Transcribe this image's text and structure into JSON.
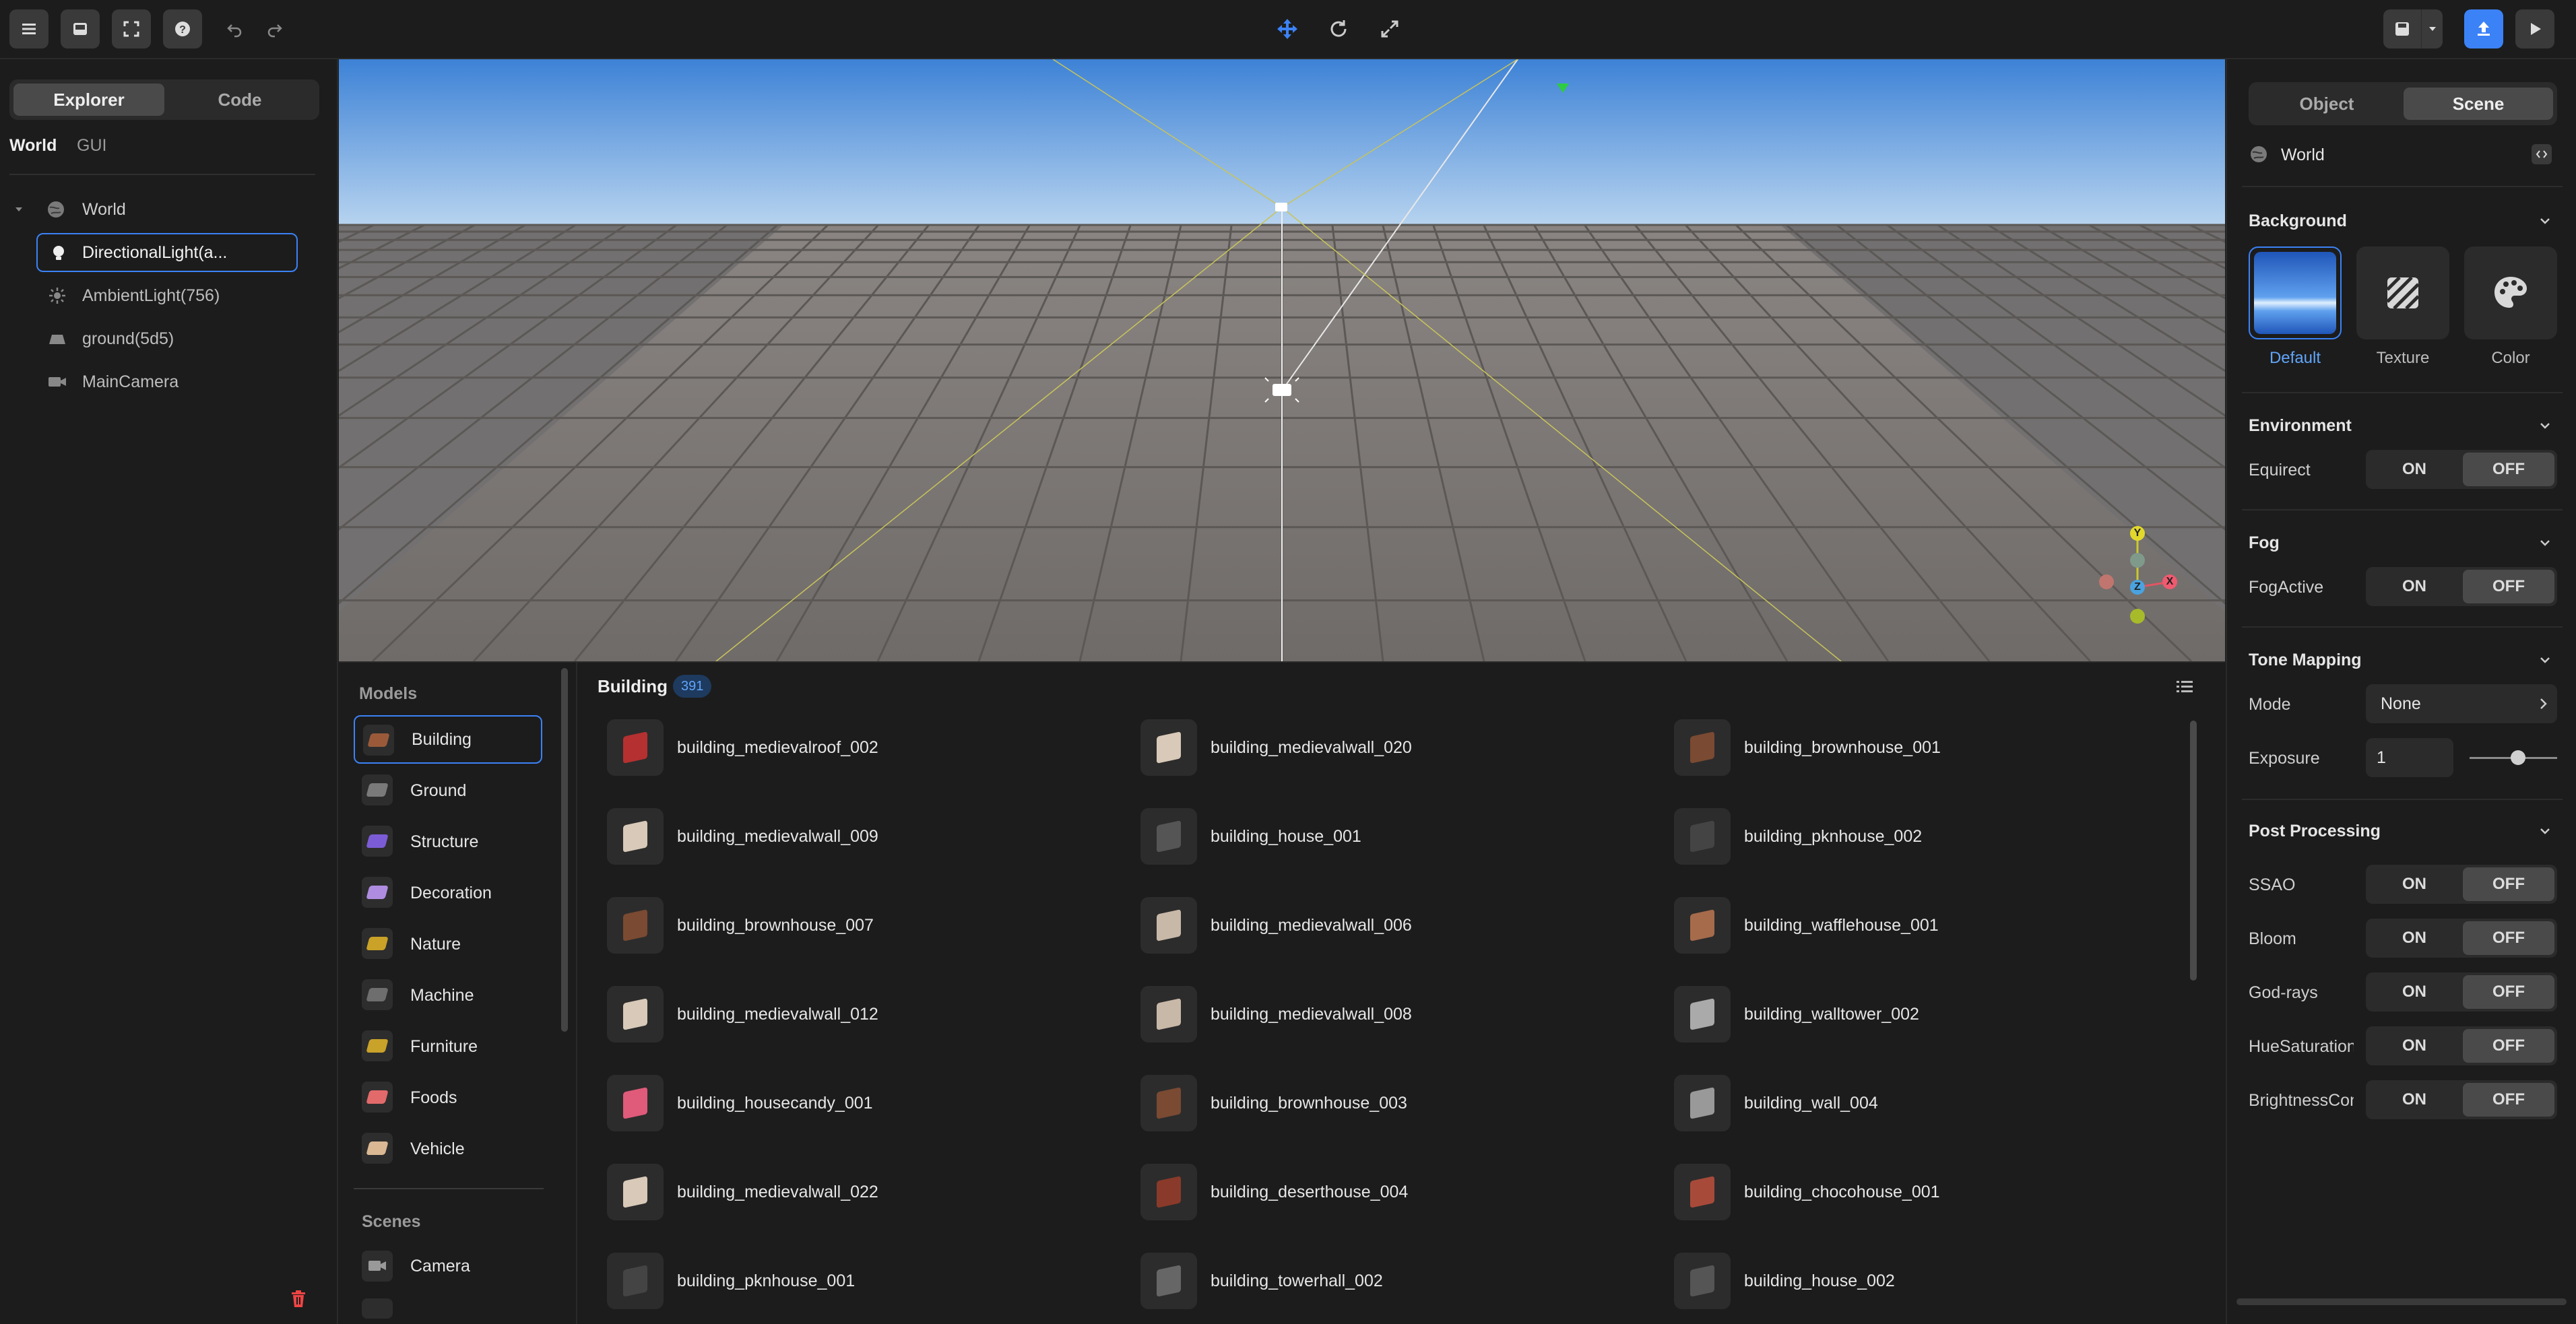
{
  "toolbar": {
    "menu_icon": "menu-icon",
    "inbox_icon": "inbox-icon",
    "fullscreen_icon": "fullscreen-icon",
    "help_icon": "help-icon",
    "undo_icon": "undo-icon",
    "redo_icon": "redo-icon",
    "move_icon": "move-icon",
    "rotate_icon": "rotate-icon",
    "scale_icon": "scale-icon",
    "save_icon": "save-icon",
    "dropdown_icon": "chevron-down-icon",
    "publish_icon": "upload-icon",
    "play_icon": "play-icon"
  },
  "left_panel": {
    "tabs": [
      {
        "label": "Explorer",
        "active": true
      },
      {
        "label": "Code",
        "active": false
      }
    ],
    "subtabs": [
      {
        "label": "World",
        "active": true
      },
      {
        "label": "GUI",
        "active": false
      }
    ],
    "tree": [
      {
        "label": "World",
        "icon": "globe-icon",
        "expanded": true
      },
      {
        "label": "DirectionalLight(a...",
        "icon": "bulb-icon",
        "selected": true
      },
      {
        "label": "AmbientLight(756)",
        "icon": "sun-icon"
      },
      {
        "label": "ground(5d5)",
        "icon": "ground-icon"
      },
      {
        "label": "MainCamera",
        "icon": "camera-icon"
      }
    ],
    "delete_icon": "trash-icon"
  },
  "viewport": {
    "gizmo_axes": {
      "y": "Y",
      "x": "X",
      "z": "Z"
    }
  },
  "asset_browser": {
    "models_heading": "Models",
    "categories": [
      {
        "label": "Building",
        "active": true
      },
      {
        "label": "Ground"
      },
      {
        "label": "Structure"
      },
      {
        "label": "Decoration"
      },
      {
        "label": "Nature"
      },
      {
        "label": "Machine"
      },
      {
        "label": "Furniture"
      },
      {
        "label": "Foods"
      },
      {
        "label": "Vehicle"
      }
    ],
    "scenes_heading": "Scenes",
    "scene_categories": [
      {
        "label": "Camera"
      }
    ],
    "current_category": "Building",
    "count": "391",
    "items": [
      "building_medievalroof_002",
      "building_medievalwall_020",
      "building_brownhouse_001",
      "building_medievalwall_009",
      "building_house_001",
      "building_pknhouse_002",
      "building_brownhouse_007",
      "building_medievalwall_006",
      "building_wafflehouse_001",
      "building_medievalwall_012",
      "building_medievalwall_008",
      "building_walltower_002",
      "building_housecandy_001",
      "building_brownhouse_003",
      "building_wall_004",
      "building_medievalwall_022",
      "building_deserthouse_004",
      "building_chocohouse_001",
      "building_pknhouse_001",
      "building_towerhall_002",
      "building_house_002"
    ]
  },
  "right_panel": {
    "tabs": [
      {
        "label": "Object",
        "active": false
      },
      {
        "label": "Scene",
        "active": true
      }
    ],
    "world_label": "World",
    "background": {
      "title": "Background",
      "options": [
        {
          "label": "Default",
          "active": true
        },
        {
          "label": "Texture"
        },
        {
          "label": "Color"
        }
      ]
    },
    "environment": {
      "title": "Environment",
      "equirect_label": "Equirect",
      "on": "ON",
      "off": "OFF"
    },
    "fog": {
      "title": "Fog",
      "fogactive_label": "FogActive",
      "on": "ON",
      "off": "OFF"
    },
    "tone_mapping": {
      "title": "Tone Mapping",
      "mode_label": "Mode",
      "mode_value": "None",
      "exposure_label": "Exposure",
      "exposure_value": "1",
      "exposure_fraction": 0.55
    },
    "post_processing": {
      "title": "Post Processing",
      "rows": [
        {
          "label": "SSAO",
          "on": "ON",
          "off": "OFF"
        },
        {
          "label": "Bloom",
          "on": "ON",
          "off": "OFF"
        },
        {
          "label": "God-rays",
          "on": "ON",
          "off": "OFF"
        },
        {
          "label": "HueSaturation",
          "on": "ON",
          "off": "OFF"
        },
        {
          "label": "BrightnessContrast",
          "on": "ON",
          "off": "OFF"
        }
      ]
    },
    "accent_color": "#3b82f6"
  }
}
